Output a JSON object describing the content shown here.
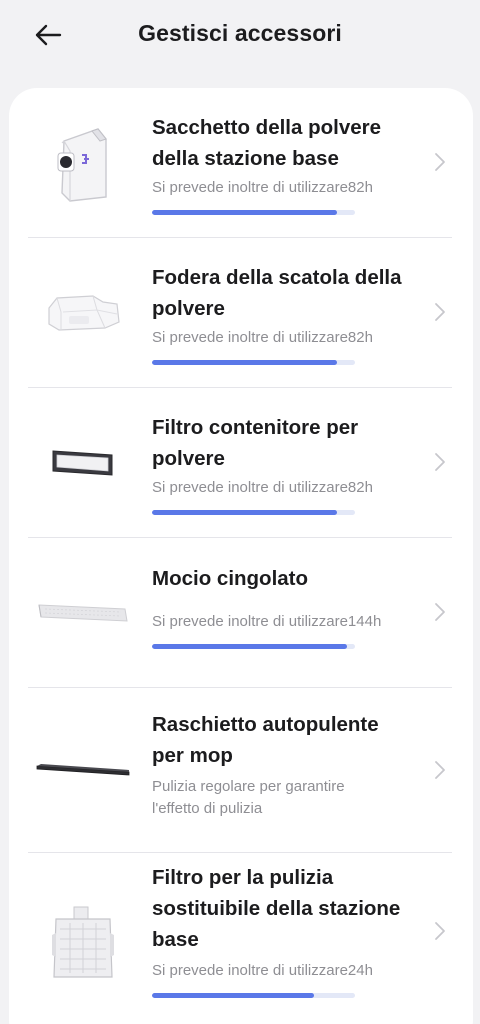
{
  "header": {
    "title": "Gestisci accessori"
  },
  "colors": {
    "progress": "#5a78e8",
    "track": "#e3e8f7",
    "background": "#f2f2f4"
  },
  "items": [
    {
      "title_lines": [
        "Sacchetto della polvere",
        "della stazione base"
      ],
      "subtitle": "Si prevede inoltre di utilizzare82h",
      "progress": 0.91,
      "icon": "dust-bag-icon"
    },
    {
      "title_lines": [
        "Fodera della scatola della",
        "polvere"
      ],
      "subtitle": "Si prevede inoltre di utilizzare82h",
      "progress": 0.91,
      "icon": "dust-box-liner-icon"
    },
    {
      "title_lines": [
        "Filtro contenitore per",
        "polvere"
      ],
      "subtitle": "Si prevede inoltre di utilizzare82h",
      "progress": 0.91,
      "icon": "bin-filter-icon"
    },
    {
      "title_lines": [
        "Mocio cingolato"
      ],
      "subtitle": "Si prevede inoltre di utilizzare144h",
      "progress": 0.96,
      "icon": "track-mop-icon"
    },
    {
      "title_lines": [
        "Raschietto autopulente",
        "per mop"
      ],
      "subtitle_lines": [
        "Pulizia regolare per garantire",
        "l'effetto di pulizia"
      ],
      "icon": "mop-scraper-icon"
    },
    {
      "title_lines": [
        "Filtro per la pulizia",
        "sostituibile della stazione",
        "base"
      ],
      "subtitle": "Si prevede inoltre di utilizzare24h",
      "progress": 0.8,
      "icon": "station-filter-icon"
    }
  ]
}
